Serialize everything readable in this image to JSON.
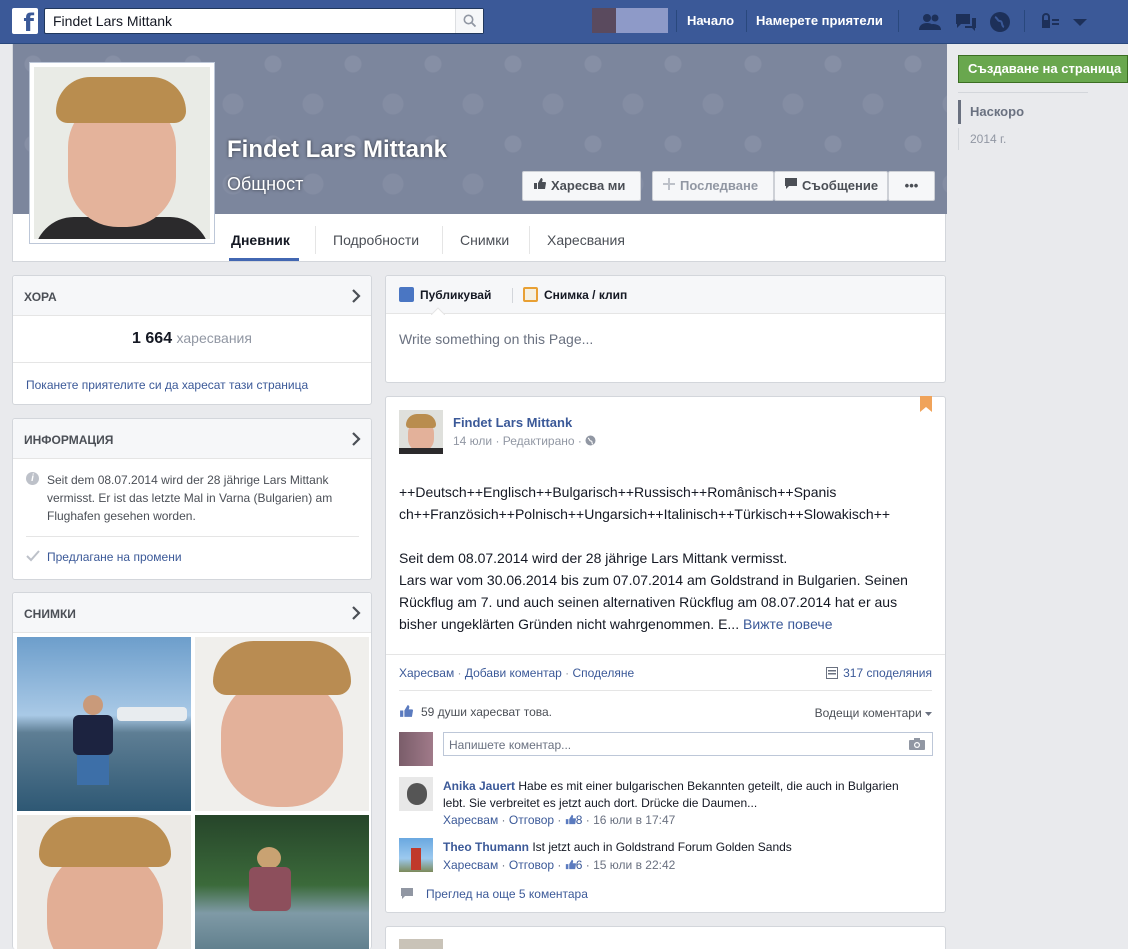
{
  "header": {
    "search_value": "Findet Lars Mittank",
    "nav_home": "Начало",
    "nav_find_friends": "Намерете приятели"
  },
  "page": {
    "name": "Findet Lars Mittank",
    "category": "Общност",
    "buttons": {
      "like": "Харесва ми",
      "follow": "Последване",
      "message": "Съобщение",
      "more": "•••"
    },
    "tabs": [
      "Дневник",
      "Подробности",
      "Снимки",
      "Харесвания"
    ]
  },
  "left": {
    "people": {
      "title": "ХОРА",
      "count": "1 664",
      "count_label": "харесвания",
      "invite": "Поканете приятелите си да харесат тази страница"
    },
    "about": {
      "title": "ИНФОРМАЦИЯ",
      "text": "Seit dem 08.07.2014 wird der 28 jährige Lars Mittank vermisst. Er ist das letzte Mal in Varna (Bulgarien) am Flughafen gesehen worden.",
      "suggest": "Предлагане на промени"
    },
    "photos": {
      "title": "СНИМКИ"
    }
  },
  "composer": {
    "tab_post": "Публикувай",
    "tab_photo": "Снимка / клип",
    "placeholder": "Write something on this Page..."
  },
  "post": {
    "author": "Findet Lars Mittank",
    "meta": "14 юли · Редактирано ·",
    "line1": "++Deutsch++Englisch++Bulgarisch++Russisch++Românisch++Spanis",
    "line2": "ch++Französich++Polnisch++Ungarsich++Italinisch++Türkisch++Slowakisch++",
    "p2a": "Seit dem 08.07.2014 wird der 28 jährige Lars Mittank vermisst.",
    "p2b": "Lars war vom 30.06.2014 bis zum 07.07.2014 am Goldstrand in Bulgarien. Seinen Rückflug am 7. und auch seinen alternativen Rückflug am 08.07.2014 hat er aus bisher ungeklärten Gründen nicht wahrgenommen. E...",
    "see_more": "Вижте повече",
    "action_like": "Харесвам",
    "action_comment": "Добави коментар",
    "action_share": "Споделяне",
    "shares": "317 споделяния",
    "likes": "59 души харесват това.",
    "top_comments": "Водещи коментари",
    "comment_placeholder": "Напишете коментар...",
    "comments": [
      {
        "name": "Anika Jauert",
        "text": "Habe es mit einer bulgarischen Bekannten geteilt, die auch in Bulgarien lebt. Sie verbreitet es jetzt auch dort. Drücke die Daumen...",
        "like": "Харесвам",
        "reply": "Отговор",
        "likes": "8",
        "time": "16 юли в 17:47"
      },
      {
        "name": "Theo Thumann",
        "text": "Ist jetzt auch in Goldstrand Forum Golden Sands",
        "like": "Харесвам",
        "reply": "Отговор",
        "likes": "6",
        "time": "15 юли в 22:42"
      }
    ],
    "more_comments": "Преглед на още 5 коментара"
  },
  "right": {
    "create_page": "Създаване на страница",
    "recent": "Наскоро",
    "year": "2014 г."
  },
  "colors": {
    "brand": "#3b5998",
    "create_button": "#69a74e"
  }
}
